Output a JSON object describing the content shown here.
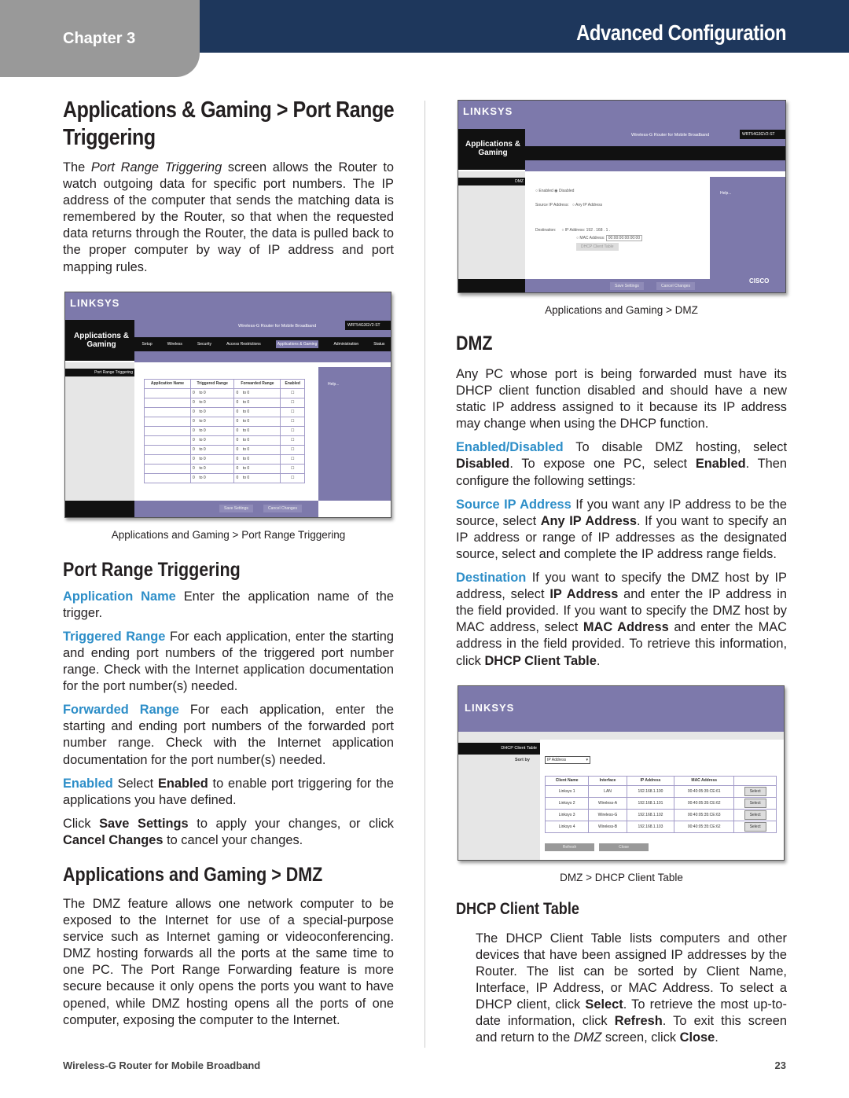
{
  "header": {
    "chapter": "Chapter 3",
    "section": "Advanced Configuration"
  },
  "left": {
    "title": "Applications & Gaming > Port Range Triggering",
    "intro": [
      {
        "t": "The "
      },
      {
        "t": "Port Range Triggering",
        "s": "i"
      },
      {
        "t": " screen allows the Router to watch outgoing data for specific port numbers. The IP address of the computer that sends the matching data is remembered by the Router, so that when the requested data returns through the Router, the data is pulled back to the proper computer by way of IP address and port mapping rules."
      }
    ],
    "caption1": "Applications and Gaming > Port Range Triggering",
    "subtitle": "Port Range Triggering",
    "items": [
      [
        {
          "t": "Application Name",
          "s": "term"
        },
        {
          "t": "  Enter the application name of the trigger."
        }
      ],
      [
        {
          "t": "Triggered Range",
          "s": "term"
        },
        {
          "t": "  For each application, enter the starting and ending port numbers of the triggered port number range. Check with the Internet application documentation for the port number(s) needed."
        }
      ],
      [
        {
          "t": "Forwarded Range",
          "s": "term"
        },
        {
          "t": "  For each application, enter the starting and ending port numbers of the forwarded port number range. Check with the Internet application documentation for the port number(s) needed."
        }
      ],
      [
        {
          "t": "Enabled",
          "s": "term"
        },
        {
          "t": "  Select "
        },
        {
          "t": "Enabled",
          "s": "b"
        },
        {
          "t": " to enable port triggering for the applications you have defined."
        }
      ],
      [
        {
          "t": "Click "
        },
        {
          "t": "Save Settings",
          "s": "b"
        },
        {
          "t": " to apply your changes, or click "
        },
        {
          "t": "Cancel Changes",
          "s": "b"
        },
        {
          "t": " to cancel your changes."
        }
      ]
    ],
    "title2": "Applications and Gaming > DMZ",
    "dmz_intro": [
      {
        "t": "The DMZ feature allows one network computer to be exposed to the Internet for use of a special-purpose service such as Internet gaming or videoconferencing. DMZ hosting forwards all the ports at the same time to one PC. The Port Range Forwarding feature is more secure because it only opens the ports you want to have opened, while DMZ hosting opens all the ports of one computer, exposing the computer to the Internet."
      }
    ]
  },
  "right": {
    "caption_dmz": "Applications and Gaming > DMZ",
    "dmz_title": "DMZ",
    "items": [
      [
        {
          "t": "Any PC whose port is being forwarded must have its DHCP client function disabled and should have a new static IP address assigned to it because its IP address may change when using the DHCP function."
        }
      ],
      [
        {
          "t": "Enabled/Disabled",
          "s": "term"
        },
        {
          "t": "  To disable DMZ hosting, select "
        },
        {
          "t": "Disabled",
          "s": "b"
        },
        {
          "t": ". To expose one PC, select "
        },
        {
          "t": "Enabled",
          "s": "b"
        },
        {
          "t": ". Then configure the following settings:"
        }
      ],
      [
        {
          "t": "Source IP Address",
          "s": "term"
        },
        {
          "t": "  If you want any IP address to be the source, select "
        },
        {
          "t": "Any IP Address",
          "s": "b"
        },
        {
          "t": ". If you want to specify an IP address or range of IP addresses as the designated source, select and complete the IP address range fields."
        }
      ],
      [
        {
          "t": "Destination",
          "s": "term"
        },
        {
          "t": "  If you want to specify the DMZ host by IP address, select "
        },
        {
          "t": "IP Address",
          "s": "b"
        },
        {
          "t": " and enter the IP address in the field provided. If you want to specify the DMZ host by MAC address, select "
        },
        {
          "t": "MAC Address",
          "s": "b"
        },
        {
          "t": " and enter the MAC address in the field provided. To retrieve this information, click "
        },
        {
          "t": "DHCP Client Table",
          "s": "b"
        },
        {
          "t": "."
        }
      ]
    ],
    "caption_dhcp": "DMZ > DHCP Client Table",
    "dhcp_title": "DHCP Client Table",
    "dhcp_text": [
      {
        "t": "The DHCP Client Table lists computers and other devices that have been assigned IP addresses by the Router. The list can be sorted by Client Name, Interface, IP Address, or MAC Address. To select a DHCP client, click "
      },
      {
        "t": "Select",
        "s": "b"
      },
      {
        "t": ". To retrieve the most up-to-date information, click "
      },
      {
        "t": "Refresh",
        "s": "b"
      },
      {
        "t": ". To exit this screen and return to the "
      },
      {
        "t": "DMZ",
        "s": "i"
      },
      {
        "t": " screen, click "
      },
      {
        "t": "Close",
        "s": "b"
      },
      {
        "t": "."
      }
    ]
  },
  "router_ui": {
    "logo": "LINKSYS",
    "section": "Applications & Gaming",
    "product": "Wireless-G Router for Mobile Broadband",
    "model": "WRT54G3GV2-ST",
    "tabs": [
      "Setup",
      "Wireless",
      "Security",
      "Access Restrictions",
      "Applications & Gaming",
      "Administration",
      "Status"
    ],
    "help": "Help...",
    "cisco": "CISCO",
    "save": "Save Settings",
    "cancel": "Cancel Changes",
    "prt_label": "Port Range Triggering",
    "prt_headers": [
      "Application Name",
      "Triggered Range",
      "Forwarded Range",
      "Enabled"
    ],
    "prt_to": "to",
    "prt_zero": "0",
    "dmz_label": "DMZ",
    "dmz_enabled": "Enabled",
    "dmz_disabled": "Disabled",
    "dmz_source": "Source IP Address:",
    "dmz_any": "Any IP Address",
    "dmz_dest": "Destination:",
    "dmz_ip": "IP Address: 192 . 168 . 1 .",
    "dmz_mac": "MAC Address:",
    "dmz_mac_val": "00:00:00:00:00:00",
    "dmz_dhcp_btn": "DHCP Client Table",
    "dhcp_label": "DHCP Client Table",
    "sort_by": "Sort by",
    "sort_value": "IP Address",
    "dhcp_headers": [
      "Client Name",
      "Interface",
      "IP Address",
      "MAC Address"
    ],
    "dhcp_rows": [
      [
        "Linksys 1",
        "LAN",
        "192.168.1.100",
        "00:40:05:35:CE:61"
      ],
      [
        "Linksys 2",
        "Wireless-A",
        "192.168.1.101",
        "00:40:05:35:CE:62"
      ],
      [
        "Linksys 3",
        "Wireless-G",
        "192.168.1.102",
        "00:40:05:35:CE:63"
      ],
      [
        "Linksys 4",
        "Wireless-B",
        "192.168.1.103",
        "00:40:05:35:CE:62"
      ]
    ],
    "select": "Select",
    "refresh": "Refresh",
    "close": "Close"
  },
  "footer": {
    "product": "Wireless-G Router for Mobile Broadband",
    "page": "23"
  },
  "colors": {
    "header_blue": "#1e375c",
    "chapter_gray": "#999999",
    "term_blue": "#2d8ec8",
    "router_purple": "#7d79ab"
  }
}
